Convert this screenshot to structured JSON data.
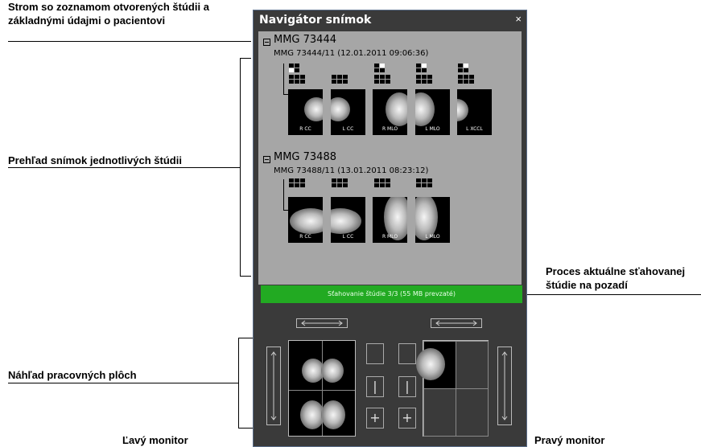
{
  "callouts": {
    "tree_line1": "Strom so zoznamom otvorených štúdii a",
    "tree_line2": "základnými údajmi o pacientovi",
    "overview": "Prehľad snímok jednotlivých štúdii",
    "process_line1": "Proces aktuálne sťahovanej",
    "process_line2": "štúdie na pozadí",
    "workspace": "Náhľad pracovných plôch",
    "left_monitor": "Ľavý monitor",
    "right_monitor": "Pravý monitor"
  },
  "window": {
    "title": "Navigátor snímok",
    "close": "×"
  },
  "studies": [
    {
      "name": "MMG 73444",
      "sub": "MMG 73444/11 (12.01.2011 09:06:36)",
      "images": [
        "R CC",
        "L CC",
        "R MLO",
        "L MLO",
        "L XCCL"
      ]
    },
    {
      "name": "MMG 73488",
      "sub": "MMG 73488/11 (13.01.2011 08:23:12)",
      "images": [
        "R CC",
        "L CC",
        "R MLO",
        "L MLO"
      ]
    }
  ],
  "progress": "Sťahovanie štúdie 3/3 (55 MB prevzaté)",
  "buttons": {
    "split_vertical": "|",
    "split_plus": "+"
  }
}
